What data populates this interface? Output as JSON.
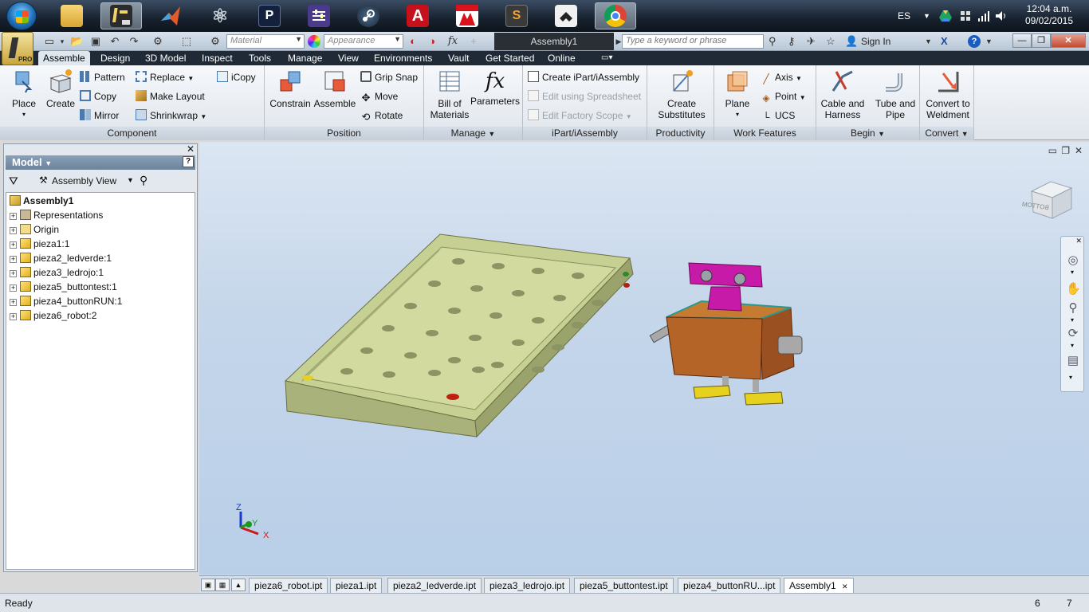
{
  "taskbar": {
    "apps": [
      {
        "name": "file-explorer-icon",
        "glyph": "",
        "color": "#e8b84a"
      },
      {
        "name": "inventor-icon",
        "glyph": "I",
        "color": "#3a3a3a",
        "active": true
      },
      {
        "name": "matlab-icon",
        "glyph": "",
        "color": "#d4502a"
      },
      {
        "name": "atom-icon",
        "glyph": "⚛",
        "color": "#6f7b88"
      },
      {
        "name": "proteus-icon",
        "glyph": "P",
        "color": "#1a2a4a"
      },
      {
        "name": "equalizer-icon",
        "glyph": "≡",
        "color": "#4b3a86"
      },
      {
        "name": "steam-icon",
        "glyph": "◉",
        "color": "#1b2838"
      },
      {
        "name": "autocad-icon",
        "glyph": "A",
        "color": "#c0101a"
      },
      {
        "name": "mplab-icon",
        "glyph": "M",
        "color": "#d9121b",
        "caption": "MPLAB IDE"
      },
      {
        "name": "sublime-icon",
        "glyph": "S",
        "color": "#4a4a4a"
      },
      {
        "name": "router-icon",
        "glyph": "⌂",
        "color": "#ececec"
      },
      {
        "name": "chrome-icon",
        "glyph": "",
        "color": "#dd4b39"
      }
    ],
    "language": "ES",
    "time": "12:04 a.m.",
    "date": "09/02/2015"
  },
  "qat": {
    "material_placeholder": "Material",
    "appearance_placeholder": "Appearance",
    "document_title": "Assembly1",
    "search_placeholder": "Type a keyword or phrase",
    "sign_in": "Sign In"
  },
  "tabs": [
    "Assemble",
    "Design",
    "3D Model",
    "Inspect",
    "Tools",
    "Manage",
    "View",
    "Environments",
    "Vault",
    "Get Started",
    "Online"
  ],
  "ribbon": {
    "component": {
      "title": "Component",
      "place": "Place",
      "create": "Create",
      "pattern": "Pattern",
      "copy": "Copy",
      "mirror": "Mirror",
      "replace": "Replace",
      "make_layout": "Make Layout",
      "shrinkwrap": "Shrinkwrap",
      "icopy": "iCopy"
    },
    "position": {
      "title": "Position",
      "constrain": "Constrain",
      "assemble": "Assemble",
      "grip_snap": "Grip Snap",
      "move": "Move",
      "rotate": "Rotate"
    },
    "manage": {
      "title": "Manage",
      "bom_line1": "Bill of",
      "bom_line2": "Materials",
      "parameters": "Parameters"
    },
    "ipart": {
      "title": "iPart/iAssembly",
      "create": "Create iPart/iAssembly",
      "edit_spreadsheet": "Edit using Spreadsheet",
      "edit_scope": "Edit Factory Scope"
    },
    "productivity": {
      "title": "Productivity",
      "line1": "Create",
      "line2": "Substitutes"
    },
    "work_features": {
      "title": "Work Features",
      "plane": "Plane",
      "axis": "Axis",
      "point": "Point",
      "ucs": "UCS"
    },
    "begin": {
      "title": "Begin",
      "cable_line1": "Cable and",
      "cable_line2": "Harness",
      "tube_line1": "Tube and",
      "tube_line2": "Pipe"
    },
    "convert": {
      "title": "Convert",
      "line1": "Convert to",
      "line2": "Weldment"
    }
  },
  "browser": {
    "header": "Model",
    "view_label": "Assembly View",
    "tree": [
      {
        "label": "Assembly1",
        "root": true
      },
      {
        "label": "Representations",
        "kind": "rep"
      },
      {
        "label": "Origin",
        "kind": "folder"
      },
      {
        "label": "pieza1:1",
        "kind": "part"
      },
      {
        "label": "pieza2_ledverde:1",
        "kind": "part"
      },
      {
        "label": "pieza3_ledrojo:1",
        "kind": "part"
      },
      {
        "label": "pieza5_buttontest:1",
        "kind": "part"
      },
      {
        "label": "pieza4_buttonRUN:1",
        "kind": "part"
      },
      {
        "label": "pieza6_robot:2",
        "kind": "part"
      }
    ]
  },
  "viewport": {
    "viewcube_label": "BOTTOM",
    "axis_z": "Z",
    "axis_y": "Y",
    "axis_x": "X",
    "colors": {
      "board": "#c8d296",
      "robot_body": "#b05a1e",
      "robot_head": "#c81aa8",
      "robot_feet": "#e6d21e",
      "robot_arms": "#a0a0a0"
    }
  },
  "doc_tabs": [
    "pieza6_robot.ipt",
    "pieza1.ipt",
    "pieza2_ledverde.ipt",
    "pieza3_ledrojo.ipt",
    "pieza5_buttontest.ipt",
    "pieza4_buttonRU...ipt",
    "Assembly1"
  ],
  "status": {
    "text": "Ready",
    "count1": "6",
    "count2": "7"
  }
}
